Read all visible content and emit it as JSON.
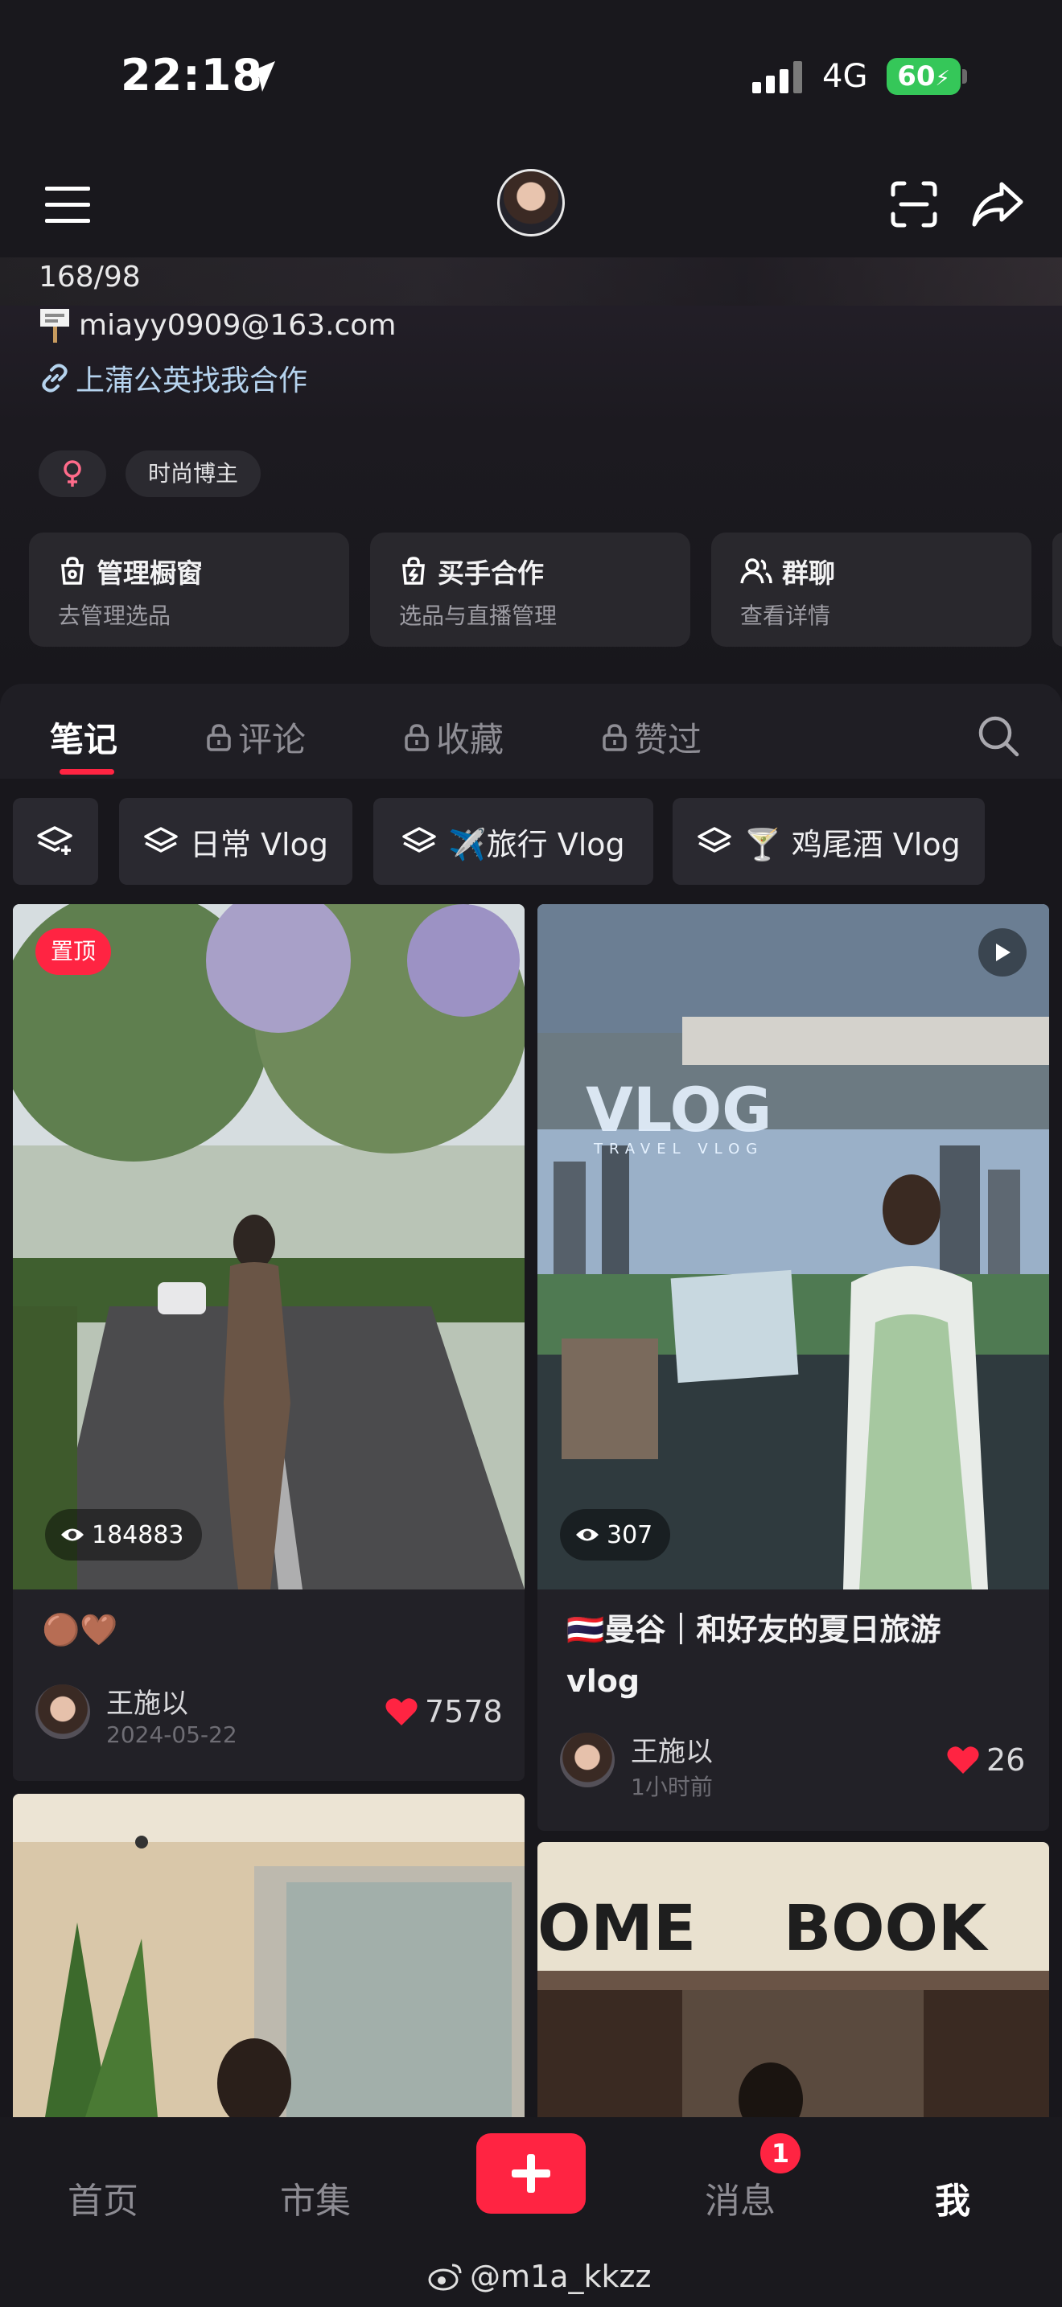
{
  "status_bar": {
    "time": "22:18",
    "network": "4G",
    "battery": "60",
    "icons": [
      "location-arrow-icon",
      "signal-bars-icon",
      "charging-bolt-icon"
    ]
  },
  "nav": {
    "icons": [
      "menu-icon",
      "avatar",
      "scan-icon",
      "share-icon"
    ]
  },
  "profile": {
    "bio_line_1": "168/98",
    "email": "miayy0909@163.com",
    "link_text": "上蒲公英找我合作",
    "gender_icon": "female-icon",
    "tag": "时尚博主",
    "cards": [
      {
        "title": "管理橱窗",
        "subtitle": "去管理选品",
        "icon": "shop-bag-icon"
      },
      {
        "title": "买手合作",
        "subtitle": "选品与直播管理",
        "icon": "lightning-bag-icon"
      },
      {
        "title": "群聊",
        "subtitle": "查看详情",
        "icon": "group-icon"
      }
    ]
  },
  "tabs": [
    {
      "label": "笔记",
      "locked": false,
      "active": true
    },
    {
      "label": "评论",
      "locked": true
    },
    {
      "label": "收藏",
      "locked": true
    },
    {
      "label": "赞过",
      "locked": true
    }
  ],
  "chips": [
    {
      "label": ""
    },
    {
      "label": "日常 Vlog"
    },
    {
      "label": "✈️旅行 Vlog"
    },
    {
      "label": "🍸 鸡尾酒 Vlog"
    }
  ],
  "posts": [
    {
      "pin_label": "置顶",
      "views": "184883",
      "title": "🟤🤎",
      "author": "王施以",
      "time": "2024-05-22",
      "likes": "7578"
    },
    {
      "views": "307",
      "title": "🇹🇭曼谷｜和好友的夏日旅游vlog",
      "title_line_1": "🇹🇭曼谷｜和好友的夏日旅游",
      "title_line_2": "vlog",
      "author": "王施以",
      "time": "1小时前",
      "likes": "26",
      "image_text": "VLOG",
      "image_subtext": "TRAVEL VLOG"
    },
    {},
    {
      "image_text": "OME    BOOK"
    }
  ],
  "bottom_nav": {
    "home": "首页",
    "market": "市集",
    "messages": "消息",
    "me": "我",
    "badge": "1"
  },
  "watermark": "@m1a_kkzz",
  "colors": {
    "accent": "#ff2442",
    "background": "#18171c",
    "link": "#b5d3ee",
    "battery": "#35c759"
  }
}
